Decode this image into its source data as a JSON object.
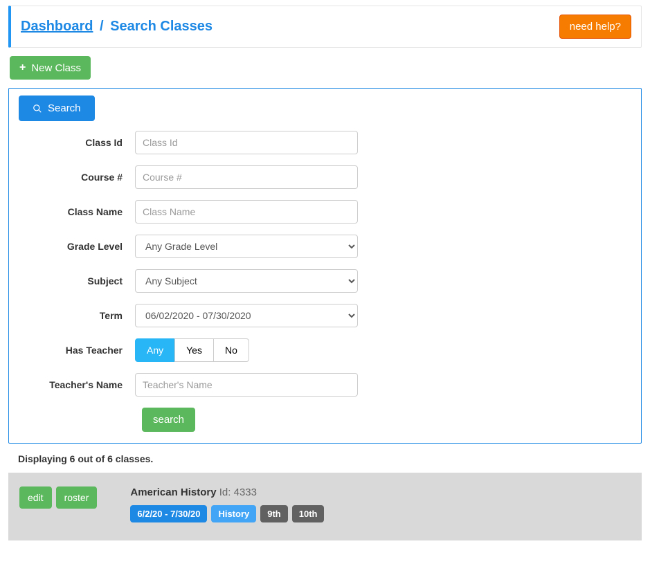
{
  "breadcrumb": {
    "dashboard": "Dashboard",
    "separator": "/",
    "current": "Search Classes"
  },
  "header": {
    "need_help": "need help?"
  },
  "actions": {
    "new_class": "New Class"
  },
  "search": {
    "tab_label": "Search",
    "fields": {
      "class_id": {
        "label": "Class Id",
        "placeholder": "Class Id",
        "value": ""
      },
      "course_num": {
        "label": "Course #",
        "placeholder": "Course #",
        "value": ""
      },
      "class_name": {
        "label": "Class Name",
        "placeholder": "Class Name",
        "value": ""
      },
      "grade_level": {
        "label": "Grade Level",
        "selected": "Any Grade Level"
      },
      "subject": {
        "label": "Subject",
        "selected": "Any Subject"
      },
      "term": {
        "label": "Term",
        "selected": "06/02/2020 - 07/30/2020"
      },
      "has_teacher": {
        "label": "Has Teacher",
        "options": {
          "any": "Any",
          "yes": "Yes",
          "no": "No"
        },
        "selected": "Any"
      },
      "teacher_name": {
        "label": "Teacher's Name",
        "placeholder": "Teacher's Name",
        "value": ""
      }
    },
    "submit": "search"
  },
  "results": {
    "summary": "Displaying 6 out of 6 classes.",
    "items": [
      {
        "edit_label": "edit",
        "roster_label": "roster",
        "name": "American History",
        "id_label": "Id:",
        "id_value": "4333",
        "badges": {
          "term": "6/2/20 - 7/30/20",
          "subject": "History",
          "grade1": "9th",
          "grade2": "10th"
        }
      }
    ]
  }
}
